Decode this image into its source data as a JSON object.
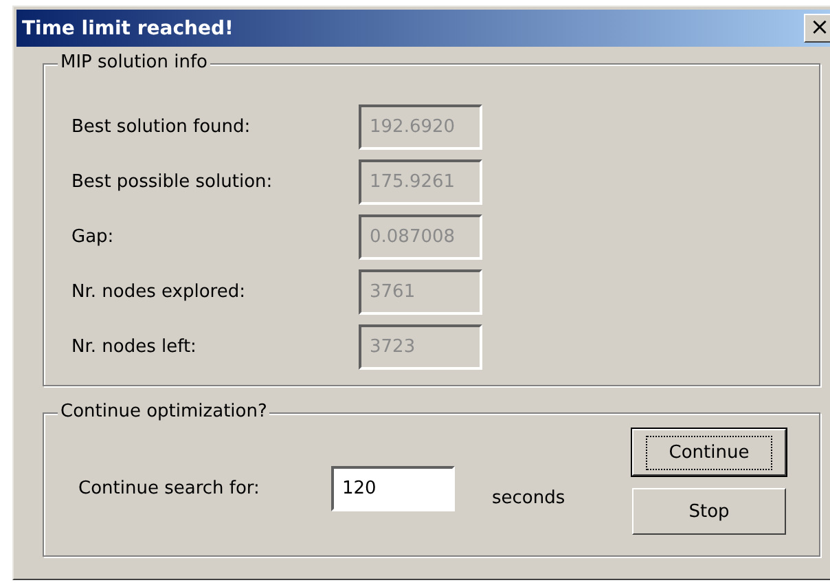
{
  "window": {
    "title": "Time limit reached!",
    "close": "×"
  },
  "solution_info": {
    "title": "MIP solution info",
    "fields": [
      {
        "label": "Best solution found:",
        "value": "192.6920",
        "disabled": true
      },
      {
        "label": "Best possible solution:",
        "value": "175.9261",
        "disabled": true
      },
      {
        "label": "Gap:",
        "value": "0.087008",
        "disabled": true
      },
      {
        "label": "Nr. nodes explored:",
        "value": "3761",
        "disabled": true
      },
      {
        "label": "Nr. nodes left:",
        "value": "3723",
        "disabled": true
      }
    ]
  },
  "continue": {
    "title": "Continue optimization?",
    "label": "Continue search for:",
    "value": "120",
    "unit": "seconds",
    "buttons": [
      {
        "label": "Continue",
        "focused": true
      },
      {
        "label": "Stop",
        "focused": false
      }
    ]
  }
}
